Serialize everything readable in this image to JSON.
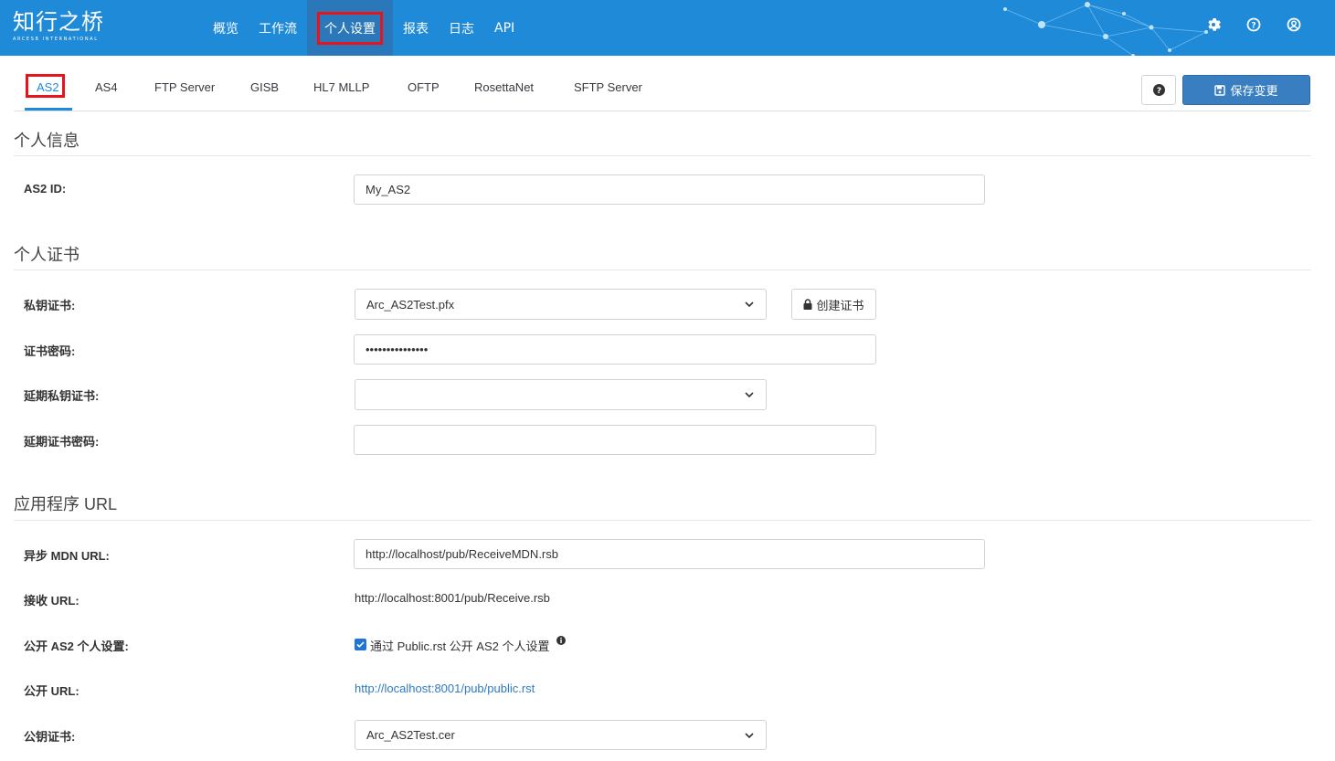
{
  "header": {
    "logo_cn": "知行之桥",
    "logo_en": "ARCESB INTERNATIONAL",
    "nav": [
      "概览",
      "工作流",
      "个人设置",
      "报表",
      "日志",
      "API"
    ],
    "active_nav": "个人设置",
    "icons": [
      "gear-icon",
      "help-circle-icon",
      "user-circle-icon"
    ]
  },
  "tabs": [
    "AS2",
    "AS4",
    "FTP Server",
    "GISB",
    "HL7 MLLP",
    "OFTP",
    "RosettaNet",
    "SFTP Server"
  ],
  "active_tab": "AS2",
  "toolbar": {
    "save_label": "保存变更"
  },
  "sections": {
    "personal_info": "个人信息",
    "personal_cert": "个人证书",
    "app_url": "应用程序 URL"
  },
  "fields": {
    "as2_id": {
      "label": "AS2 ID:",
      "value": "My_AS2"
    },
    "private_cert": {
      "label": "私钥证书:",
      "value": "Arc_AS2Test.pfx"
    },
    "create_cert": "创建证书",
    "cert_password": {
      "label": "证书密码:",
      "value": "•••••••••••••••"
    },
    "ext_private_cert": {
      "label": "延期私钥证书:",
      "value": ""
    },
    "ext_cert_password": {
      "label": "延期证书密码:",
      "value": ""
    },
    "async_mdn_url": {
      "label": "异步 MDN URL:",
      "value": "http://localhost/pub/ReceiveMDN.rsb"
    },
    "receive_url": {
      "label": "接收 URL:",
      "value": "http://localhost:8001/pub/Receive.rsb"
    },
    "publish_profile": {
      "label": "公开 AS2 个人设置:",
      "checkbox_label": "通过 Public.rst 公开 AS2 个人设置",
      "checked": true
    },
    "public_url": {
      "label": "公开 URL:",
      "value": "http://localhost:8001/pub/public.rst"
    },
    "public_cert": {
      "label": "公钥证书:",
      "value": "Arc_AS2Test.cer"
    }
  },
  "colors": {
    "brand": "#1f8bd8",
    "highlight": "#e8141c",
    "save_button": "#3a7ec2",
    "link": "#2e7ac2"
  }
}
